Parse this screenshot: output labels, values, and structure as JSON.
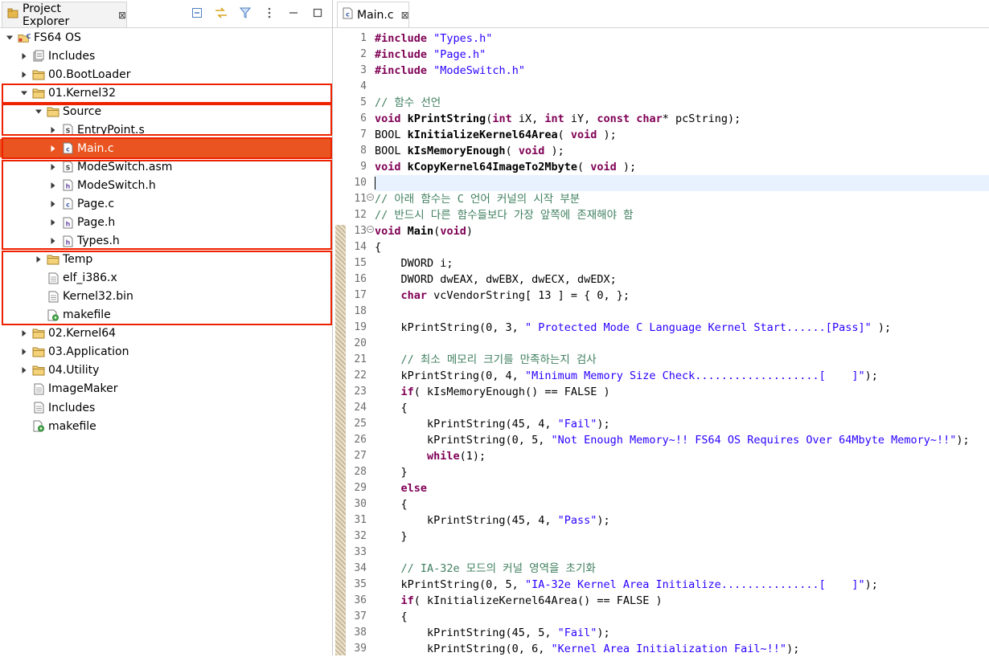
{
  "explorer": {
    "title": "Project Explorer",
    "close_glyph": "⊠",
    "tools": [
      "collapse-all-icon",
      "link-editor-icon",
      "filter-icon",
      "view-menu-icon",
      "minimize-icon",
      "maximize-icon"
    ],
    "tree": [
      {
        "label": "FS64 OS",
        "depth": 0,
        "expand": "open",
        "icon": "c-project-icon"
      },
      {
        "label": "Includes",
        "depth": 1,
        "expand": "closed",
        "icon": "includes-icon"
      },
      {
        "label": "00.BootLoader",
        "depth": 1,
        "expand": "closed",
        "icon": "folder-icon"
      },
      {
        "label": "01.Kernel32",
        "depth": 1,
        "expand": "open",
        "icon": "folder-icon"
      },
      {
        "label": "Source",
        "depth": 2,
        "expand": "open",
        "icon": "folder-icon"
      },
      {
        "label": "EntryPoint.s",
        "depth": 3,
        "expand": "closed",
        "icon": "asm-file-icon"
      },
      {
        "label": "Main.c",
        "depth": 3,
        "expand": "closed",
        "icon": "c-file-icon",
        "selected": true
      },
      {
        "label": "ModeSwitch.asm",
        "depth": 3,
        "expand": "closed",
        "icon": "asm-file-icon"
      },
      {
        "label": "ModeSwitch.h",
        "depth": 3,
        "expand": "closed",
        "icon": "h-file-icon"
      },
      {
        "label": "Page.c",
        "depth": 3,
        "expand": "closed",
        "icon": "c-file-icon"
      },
      {
        "label": "Page.h",
        "depth": 3,
        "expand": "closed",
        "icon": "h-file-icon"
      },
      {
        "label": "Types.h",
        "depth": 3,
        "expand": "closed",
        "icon": "h-file-icon"
      },
      {
        "label": "Temp",
        "depth": 2,
        "expand": "closed",
        "icon": "folder-icon"
      },
      {
        "label": "elf_i386.x",
        "depth": 2,
        "expand": "none",
        "icon": "text-file-icon"
      },
      {
        "label": "Kernel32.bin",
        "depth": 2,
        "expand": "none",
        "icon": "text-file-icon"
      },
      {
        "label": "makefile",
        "depth": 2,
        "expand": "none",
        "icon": "makefile-icon"
      },
      {
        "label": "02.Kernel64",
        "depth": 1,
        "expand": "closed",
        "icon": "folder-icon"
      },
      {
        "label": "03.Application",
        "depth": 1,
        "expand": "closed",
        "icon": "folder-icon"
      },
      {
        "label": "04.Utility",
        "depth": 1,
        "expand": "closed",
        "icon": "folder-icon"
      },
      {
        "label": "ImageMaker",
        "depth": 1,
        "expand": "none",
        "icon": "text-file-icon"
      },
      {
        "label": "Includes",
        "depth": 1,
        "expand": "none",
        "icon": "text-file-icon"
      },
      {
        "label": "makefile",
        "depth": 1,
        "expand": "none",
        "icon": "makefile-icon"
      }
    ]
  },
  "editor": {
    "tab_label": "Main.c",
    "close_glyph": "⊠",
    "current_line": 10,
    "fold_lines": [
      11,
      13
    ],
    "lines": [
      [
        [
          "kw",
          "#include"
        ],
        [
          "t",
          " "
        ],
        [
          "str",
          "\"Types.h\""
        ]
      ],
      [
        [
          "kw",
          "#include"
        ],
        [
          "t",
          " "
        ],
        [
          "str",
          "\"Page.h\""
        ]
      ],
      [
        [
          "kw",
          "#include"
        ],
        [
          "t",
          " "
        ],
        [
          "str",
          "\"ModeSwitch.h\""
        ]
      ],
      [],
      [
        [
          "cmt",
          "// 함수 선언"
        ]
      ],
      [
        [
          "kw",
          "void"
        ],
        [
          "t",
          " "
        ],
        [
          "fn",
          "kPrintString"
        ],
        [
          "t",
          "("
        ],
        [
          "kw",
          "int"
        ],
        [
          "t",
          " iX, "
        ],
        [
          "kw",
          "int"
        ],
        [
          "t",
          " iY, "
        ],
        [
          "kw",
          "const"
        ],
        [
          "t",
          " "
        ],
        [
          "kw",
          "char"
        ],
        [
          "t",
          "* pcString);"
        ]
      ],
      [
        [
          "t",
          "BOOL "
        ],
        [
          "fn",
          "kInitializeKernel64Area"
        ],
        [
          "t",
          "( "
        ],
        [
          "kw",
          "void"
        ],
        [
          "t",
          " );"
        ]
      ],
      [
        [
          "t",
          "BOOL "
        ],
        [
          "fn",
          "kIsMemoryEnough"
        ],
        [
          "t",
          "( "
        ],
        [
          "kw",
          "void"
        ],
        [
          "t",
          " );"
        ]
      ],
      [
        [
          "kw",
          "void"
        ],
        [
          "t",
          " "
        ],
        [
          "fn",
          "kCopyKernel64ImageTo2Mbyte"
        ],
        [
          "t",
          "( "
        ],
        [
          "kw",
          "void"
        ],
        [
          "t",
          " );"
        ]
      ],
      [
        [
          "caret",
          ""
        ]
      ],
      [
        [
          "cmt",
          "// 아래 함수는 C 언어 커널의 시작 부분"
        ]
      ],
      [
        [
          "cmt",
          "// 반드시 다른 함수들보다 가장 앞쪽에 존재해야 함"
        ]
      ],
      [
        [
          "kw",
          "void"
        ],
        [
          "t",
          " "
        ],
        [
          "fn",
          "Main"
        ],
        [
          "t",
          "("
        ],
        [
          "kw",
          "void"
        ],
        [
          "t",
          ")"
        ]
      ],
      [
        [
          "t",
          "{"
        ]
      ],
      [
        [
          "t",
          "    DWORD i;"
        ]
      ],
      [
        [
          "t",
          "    DWORD dwEAX, dwEBX, dwECX, dwEDX;"
        ]
      ],
      [
        [
          "t",
          "    "
        ],
        [
          "kw",
          "char"
        ],
        [
          "t",
          " vcVendorString[ 13 ] = { 0, };"
        ]
      ],
      [],
      [
        [
          "t",
          "    kPrintString(0, 3, "
        ],
        [
          "str",
          "\" Protected Mode C Language Kernel Start......[Pass]\""
        ],
        [
          "t",
          " );"
        ]
      ],
      [],
      [
        [
          "t",
          "    "
        ],
        [
          "cmt",
          "// 최소 메모리 크기를 만족하는지 검사"
        ]
      ],
      [
        [
          "t",
          "    kPrintString(0, 4, "
        ],
        [
          "str",
          "\"Minimum Memory Size Check...................[    ]\""
        ],
        [
          "t",
          ");"
        ]
      ],
      [
        [
          "t",
          "    "
        ],
        [
          "kw",
          "if"
        ],
        [
          "t",
          "( kIsMemoryEnough() == FALSE )"
        ]
      ],
      [
        [
          "t",
          "    {"
        ]
      ],
      [
        [
          "t",
          "        kPrintString(45, 4, "
        ],
        [
          "str",
          "\"Fail\""
        ],
        [
          "t",
          ");"
        ]
      ],
      [
        [
          "t",
          "        kPrintString(0, 5, "
        ],
        [
          "str",
          "\"Not Enough Memory~!! FS64 OS Requires Over 64Mbyte Memory~!!\""
        ],
        [
          "t",
          ");"
        ]
      ],
      [
        [
          "t",
          "        "
        ],
        [
          "kw",
          "while"
        ],
        [
          "t",
          "(1);"
        ]
      ],
      [
        [
          "t",
          "    }"
        ]
      ],
      [
        [
          "t",
          "    "
        ],
        [
          "kw",
          "else"
        ]
      ],
      [
        [
          "t",
          "    {"
        ]
      ],
      [
        [
          "t",
          "        kPrintString(45, 4, "
        ],
        [
          "str",
          "\"Pass\""
        ],
        [
          "t",
          ");"
        ]
      ],
      [
        [
          "t",
          "    }"
        ]
      ],
      [],
      [
        [
          "t",
          "    "
        ],
        [
          "cmt",
          "// IA-32e 모드의 커널 영역을 초기화"
        ]
      ],
      [
        [
          "t",
          "    kPrintString(0, 5, "
        ],
        [
          "str",
          "\"IA-32e Kernel Area Initialize...............[    ]\""
        ],
        [
          "t",
          ");"
        ]
      ],
      [
        [
          "t",
          "    "
        ],
        [
          "kw",
          "if"
        ],
        [
          "t",
          "( kInitializeKernel64Area() == FALSE )"
        ]
      ],
      [
        [
          "t",
          "    {"
        ]
      ],
      [
        [
          "t",
          "        kPrintString(45, 5, "
        ],
        [
          "str",
          "\"Fail\""
        ],
        [
          "t",
          ");"
        ]
      ],
      [
        [
          "t",
          "        kPrintString(0, 6, "
        ],
        [
          "str",
          "\"Kernel Area Initialization Fail~!!\""
        ],
        [
          "t",
          ");"
        ]
      ]
    ]
  },
  "colors": {
    "selection": "#e95420",
    "highlight_box": "#ee2200",
    "folder": "#e6b84c",
    "keyword": "#7f0055",
    "string": "#2a00ff",
    "comment": "#3f7f5f"
  }
}
